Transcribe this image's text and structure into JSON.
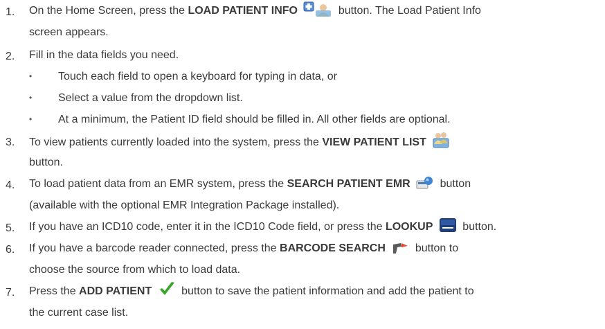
{
  "steps": [
    {
      "number": "1.",
      "before": "On the Home Screen, press the ",
      "button": "LOAD PATIENT INFO",
      "after": " button. The Load Patient Info",
      "line2": "screen appears.",
      "icon": "load-patient-info-icon"
    },
    {
      "number": "2.",
      "text": "Fill in the data fields you need.",
      "bullets": [
        "Touch each field to open a keyboard for typing in data, or",
        "Select a value from the dropdown list.",
        "At a minimum, the Patient ID field should be filled in. All other fields are optional."
      ]
    },
    {
      "number": "3.",
      "before": "To view patients currently loaded into the system, press the ",
      "button": "VIEW PATIENT LIST",
      "after": "",
      "line2": "button.",
      "icon": "view-patient-list-icon"
    },
    {
      "number": "4.",
      "before": "To load patient data from an EMR system, press the ",
      "button": "SEARCH PATIENT EMR",
      "after": " button",
      "line2": "(available with the optional EMR Integration Package installed).",
      "icon": "search-patient-emr-icon"
    },
    {
      "number": "5.",
      "before": "If you have an ICD10 code, enter it in the ICD10 Code field, or press the ",
      "button": "LOOKUP",
      "after": " button.",
      "icon": "lookup-keyboard-icon"
    },
    {
      "number": "6.",
      "before": "If you have a barcode reader connected, press the ",
      "button": "BARCODE SEARCH",
      "after": " button to",
      "line2": "choose the source from which to load data.",
      "icon": "barcode-scanner-icon"
    },
    {
      "number": "7.",
      "before": "Press the ",
      "button": "ADD PATIENT",
      "after": " button to save the patient information and add the patient to",
      "line2": "the current case list.",
      "icon": "add-patient-checkmark-icon"
    }
  ],
  "colors": {
    "text": "#3a3a3a",
    "check": "#3aa52b",
    "lookup": "#1f3f7a"
  }
}
